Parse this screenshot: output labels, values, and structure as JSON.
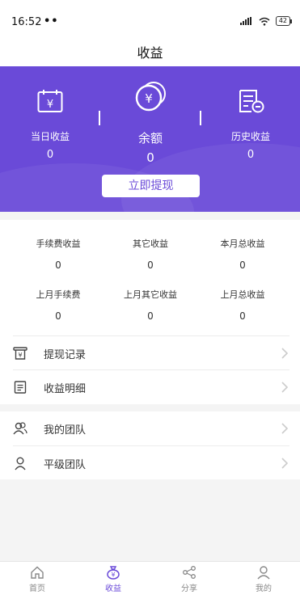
{
  "status_bar": {
    "time": "16:52",
    "dots": "••",
    "battery": "42"
  },
  "header": {
    "title": "收益"
  },
  "summary": {
    "today_label": "当日收益",
    "today_value": "0",
    "balance_label": "余额",
    "balance_value": "0",
    "history_label": "历史收益",
    "history_value": "0",
    "withdraw_label": "立即提现",
    "icons": [
      "calendar-yen-icon",
      "coin-yen-icon",
      "document-minus-icon"
    ]
  },
  "stats": [
    {
      "label": "手续费收益",
      "value": "0"
    },
    {
      "label": "其它收益",
      "value": "0"
    },
    {
      "label": "本月总收益",
      "value": "0"
    },
    {
      "label": "上月手续费",
      "value": "0"
    },
    {
      "label": "上月其它收益",
      "value": "0"
    },
    {
      "label": "上月总收益",
      "value": "0"
    }
  ],
  "menu": [
    {
      "label": "提现记录",
      "icon": "receipt-icon"
    },
    {
      "label": "收益明细",
      "icon": "list-doc-icon"
    }
  ],
  "team_menu": [
    {
      "label": "我的团队",
      "icon": "team-icon"
    },
    {
      "label": "平级团队",
      "icon": "user-icon"
    }
  ],
  "tabs": [
    {
      "label": "首页",
      "icon": "home-icon"
    },
    {
      "label": "收益",
      "icon": "earnings-bag-icon"
    },
    {
      "label": "分享",
      "icon": "share-icon"
    },
    {
      "label": "我的",
      "icon": "profile-icon"
    }
  ],
  "colors": {
    "primary": "#6a4ad8",
    "background": "#f4f4f4",
    "text": "#333333"
  }
}
